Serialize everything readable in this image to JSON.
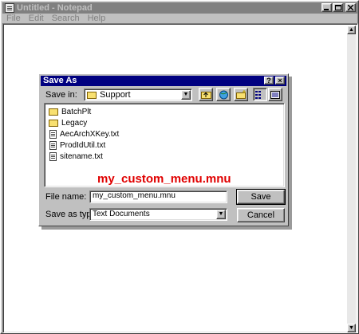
{
  "notepad": {
    "title": "Untitled - Notepad",
    "menu": [
      "File",
      "Edit",
      "Search",
      "Help"
    ]
  },
  "dialog": {
    "title": "Save As",
    "save_in_label": "Save in:",
    "save_in_value": "Support",
    "files": [
      {
        "name": "BatchPlt",
        "type": "folder"
      },
      {
        "name": "Legacy",
        "type": "folder"
      },
      {
        "name": "AecArchXKey.txt",
        "type": "text"
      },
      {
        "name": "ProdIdUtil.txt",
        "type": "text"
      },
      {
        "name": "sitename.txt",
        "type": "text"
      }
    ],
    "annotation": "my_custom_menu.mnu",
    "file_name_label": "File name:",
    "file_name_value": "my_custom_menu.mnu",
    "save_type_label": "Save as type:",
    "save_type_value": "Text Documents",
    "save_button": "Save",
    "cancel_button": "Cancel",
    "help_glyph": "?",
    "close_glyph": "×"
  },
  "colors": {
    "dialog_title_bg": "#000080",
    "inactive_title_bg": "#808080",
    "annotation": "#e00000"
  }
}
